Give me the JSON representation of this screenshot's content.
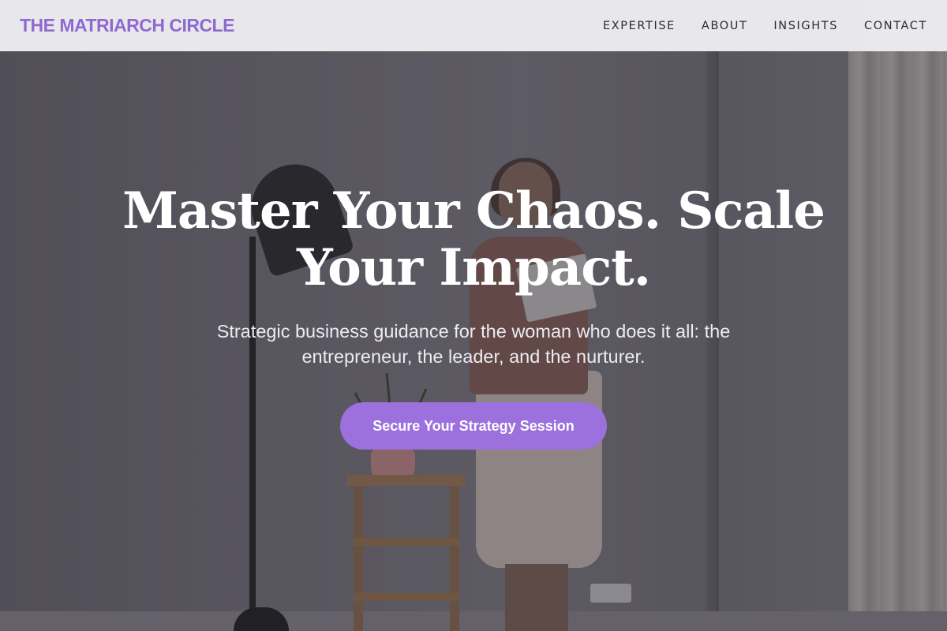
{
  "brand": {
    "name": "THE MATRIARCH CIRCLE",
    "color": "#8f69d3"
  },
  "nav": {
    "links": [
      "EXPERTISE",
      "ABOUT",
      "INSIGHTS",
      "CONTACT"
    ]
  },
  "hero": {
    "headline": "Master Your Chaos. Scale Your Impact.",
    "subtext": "Strategic business guidance for the woman who does it all: the entrepreneur, the leader, and the nurturer.",
    "cta_label": "Secure Your Strategy Session",
    "cta_color": "#9d71dd"
  }
}
